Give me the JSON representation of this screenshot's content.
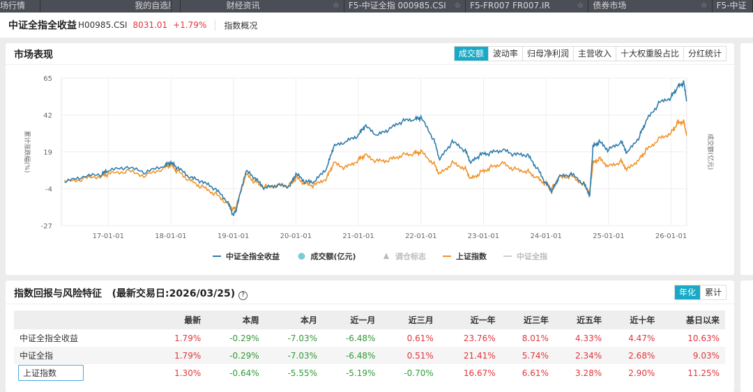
{
  "tabs": [
    {
      "label": "场行情"
    },
    {
      "label": "我的自选股"
    },
    {
      "label": "财经资讯"
    },
    {
      "label": "F5-中证全指 000985.CSI"
    },
    {
      "label": "F5-FR007 FR007.IR"
    },
    {
      "label": "债券市场"
    },
    {
      "label": "F5-中证"
    }
  ],
  "header": {
    "name": "中证全指全收益",
    "code": "H00985.CSI",
    "price": "8031.01",
    "change": "+1.79%",
    "overview": "指数概况"
  },
  "market": {
    "title": "市场表现",
    "buttons": [
      "成交额",
      "波动率",
      "归母净利润",
      "主营收入",
      "十大权重股占比",
      "分红统计"
    ],
    "active": 0
  },
  "chart_data": {
    "type": "line",
    "ylabel": "累计涨跌幅(%)",
    "y2label": "成交额(亿元)",
    "ylim": [
      -27,
      65
    ],
    "yticks": [
      65,
      42,
      19,
      -4,
      -27
    ],
    "xlim": [
      2016.25,
      2026.25
    ],
    "xticks": [
      {
        "v": 2017,
        "label": "17-01-01"
      },
      {
        "v": 2018,
        "label": "18-01-01"
      },
      {
        "v": 2019,
        "label": "19-01-01"
      },
      {
        "v": 2020,
        "label": "20-01-01"
      },
      {
        "v": 2021,
        "label": "21-01-01"
      },
      {
        "v": 2022,
        "label": "22-01-01"
      },
      {
        "v": 2023,
        "label": "23-01-01"
      },
      {
        "v": 2024,
        "label": "24-01-01"
      },
      {
        "v": 2025,
        "label": "25-01-01"
      },
      {
        "v": 2026,
        "label": "26-01-01"
      }
    ],
    "x": [
      2016.3,
      2016.6,
      2016.9,
      2017.0,
      2017.3,
      2017.6,
      2017.9,
      2018.0,
      2018.1,
      2018.3,
      2018.5,
      2018.7,
      2018.9,
      2019.0,
      2019.05,
      2019.2,
      2019.35,
      2019.5,
      2019.7,
      2019.9,
      2020.0,
      2020.15,
      2020.3,
      2020.5,
      2020.6,
      2020.8,
      2021.0,
      2021.1,
      2021.3,
      2021.5,
      2021.7,
      2021.9,
      2022.0,
      2022.2,
      2022.3,
      2022.5,
      2022.7,
      2022.8,
      2022.95,
      2023.1,
      2023.3,
      2023.5,
      2023.7,
      2023.85,
      2024.0,
      2024.1,
      2024.2,
      2024.4,
      2024.6,
      2024.7,
      2024.75,
      2024.85,
      2025.0,
      2025.2,
      2025.3,
      2025.5,
      2025.6,
      2025.8,
      2026.0,
      2026.1,
      2026.2,
      2026.25
    ],
    "series": [
      {
        "name": "中证全指全收益",
        "color": "#2d7bab",
        "values": [
          0,
          3,
          5,
          7,
          9,
          6,
          10,
          12,
          9,
          3,
          0,
          -4,
          -12,
          -21,
          -17,
          7,
          2,
          -4,
          -2,
          -3,
          5,
          0,
          0,
          9,
          22,
          25,
          29,
          35,
          29,
          33,
          38,
          39,
          40,
          27,
          14,
          25,
          20,
          12,
          17,
          18,
          20,
          17,
          17,
          9,
          -1,
          -6,
          3,
          5,
          -1,
          -8,
          22,
          25,
          20,
          25,
          18,
          29,
          38,
          49,
          53,
          59,
          62,
          51
        ]
      },
      {
        "name": "上证指数",
        "color": "#f0932b",
        "values": [
          0,
          2,
          4,
          5,
          7,
          4,
          9,
          11,
          7,
          1,
          -3,
          -7,
          -13,
          -17,
          -15,
          5,
          0,
          -3,
          -2,
          -2,
          3,
          -1,
          -2,
          3,
          12,
          9,
          14,
          17,
          13,
          14,
          17,
          18,
          19,
          12,
          5,
          12,
          9,
          2,
          6,
          9,
          12,
          8,
          7,
          3,
          -1,
          -4,
          3,
          4,
          -1,
          -6,
          12,
          15,
          10,
          13,
          8,
          15,
          20,
          27,
          31,
          37,
          38,
          30
        ]
      }
    ],
    "legend": [
      {
        "name": "中证全指全收益",
        "color": "#2d7bab",
        "shape": "line",
        "enabled": true
      },
      {
        "name": "成交额(亿元)",
        "color": "#7ecbd8",
        "shape": "dot",
        "enabled": true
      },
      {
        "name": "调仓标志",
        "color": "#bbbbbb",
        "shape": "triangle",
        "enabled": false
      },
      {
        "name": "上证指数",
        "color": "#f0932b",
        "shape": "line",
        "enabled": true
      },
      {
        "name": "中证全指",
        "color": "#cccccc",
        "shape": "line",
        "enabled": false
      }
    ],
    "legend_position": "bottom"
  },
  "returns": {
    "title": "指数回报与风险特征",
    "date": "(最新交易日:2026/03/25)",
    "help": "?",
    "buttons": [
      "年化",
      "累计"
    ],
    "columns": [
      "",
      "最新",
      "本周",
      "本月",
      "近一月",
      "近三月",
      "近一年",
      "近三年",
      "近五年",
      "近十年",
      "基日以来"
    ],
    "rows": [
      {
        "name": "中证全指全收益",
        "values": [
          "1.79%",
          "-0.29%",
          "-7.03%",
          "-6.48%",
          "0.61%",
          "23.76%",
          "8.01%",
          "4.33%",
          "4.47%",
          "10.63%"
        ]
      },
      {
        "name": "中证全指",
        "values": [
          "1.79%",
          "-0.29%",
          "-7.03%",
          "-6.48%",
          "0.51%",
          "21.41%",
          "5.74%",
          "2.34%",
          "2.68%",
          "9.03%"
        ]
      },
      {
        "name": "上证指数",
        "values": [
          "1.30%",
          "-0.64%",
          "-5.55%",
          "-5.19%",
          "-0.70%",
          "16.67%",
          "6.61%",
          "3.28%",
          "2.90%",
          "11.25%"
        ]
      }
    ]
  }
}
